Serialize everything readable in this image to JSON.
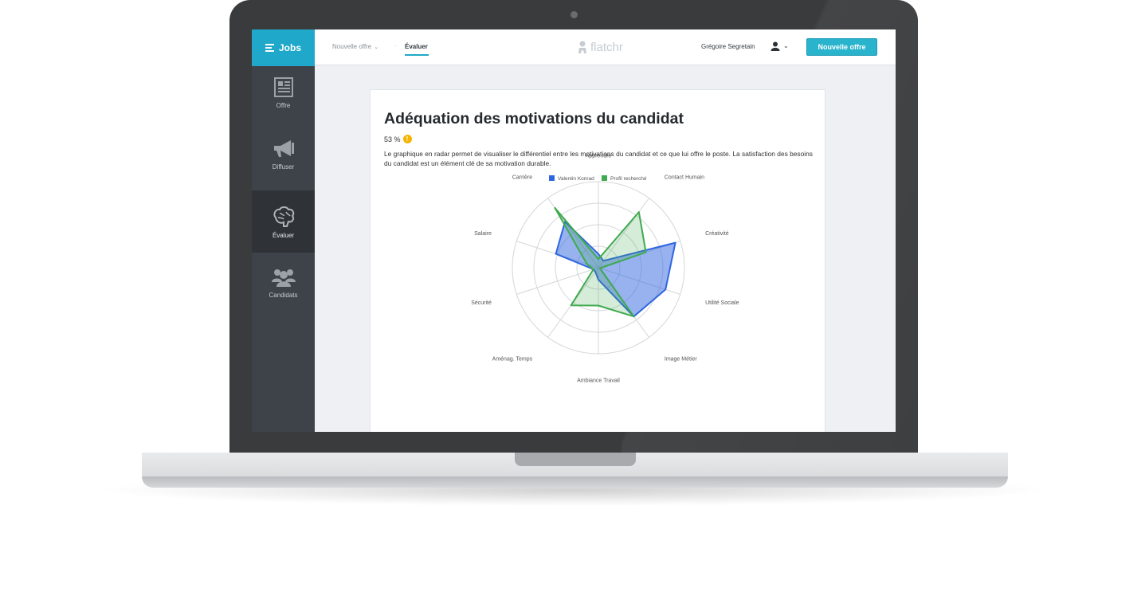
{
  "sidebar": {
    "jobs_label": "Jobs",
    "items": [
      {
        "label": "Offre",
        "icon": "newspaper-icon"
      },
      {
        "label": "Diffuser",
        "icon": "megaphone-icon"
      },
      {
        "label": "Évaluer",
        "icon": "brain-icon",
        "active": true
      },
      {
        "label": "Candidats",
        "icon": "group-icon"
      }
    ]
  },
  "topbar": {
    "breadcrumb_1": "Nouvelle offre",
    "breadcrumb_sep": "·",
    "breadcrumb_2": "Évaluer",
    "logo": "flatchr",
    "user_name": "Grégoire Segretain",
    "new_offer_button": "Nouvelle offre"
  },
  "card": {
    "title": "Adéquation des motivations du candidat",
    "score": "53 %",
    "score_icon": "!",
    "description": "Le graphique en radar permet de visualiser le différentiel entre les motivations du candidat et ce que lui offre le poste. La satisfaction des besoins du candidat est un élément clé de sa motivation durable."
  },
  "colors": {
    "accent": "#1fa8c9",
    "sidebar": "#3d4349",
    "candidate": "#2f66e0",
    "profile": "#3faa4f"
  },
  "chart_data": {
    "type": "radar",
    "axes": [
      "Apprendre",
      "Contact Humain",
      "Créativité",
      "Utilité Sociale",
      "Image Métier",
      "Ambiance Travail",
      "Aménag. Temps",
      "Sécurité",
      "Salaire",
      "Carrière"
    ],
    "range": [
      0,
      5
    ],
    "rings": 4,
    "legend_position": "top",
    "series": [
      {
        "name": "Valentin Konrad",
        "color": "#2f66e0",
        "values": [
          0.8,
          0.5,
          4.7,
          4.1,
          3.5,
          0.7,
          0.3,
          0.3,
          2.6,
          3.3
        ]
      },
      {
        "name": "Profil recherché",
        "color": "#3faa4f",
        "values": [
          0.5,
          4.0,
          2.9,
          0.1,
          3.5,
          2.2,
          2.7,
          0.3,
          0.7,
          4.3
        ]
      }
    ]
  }
}
